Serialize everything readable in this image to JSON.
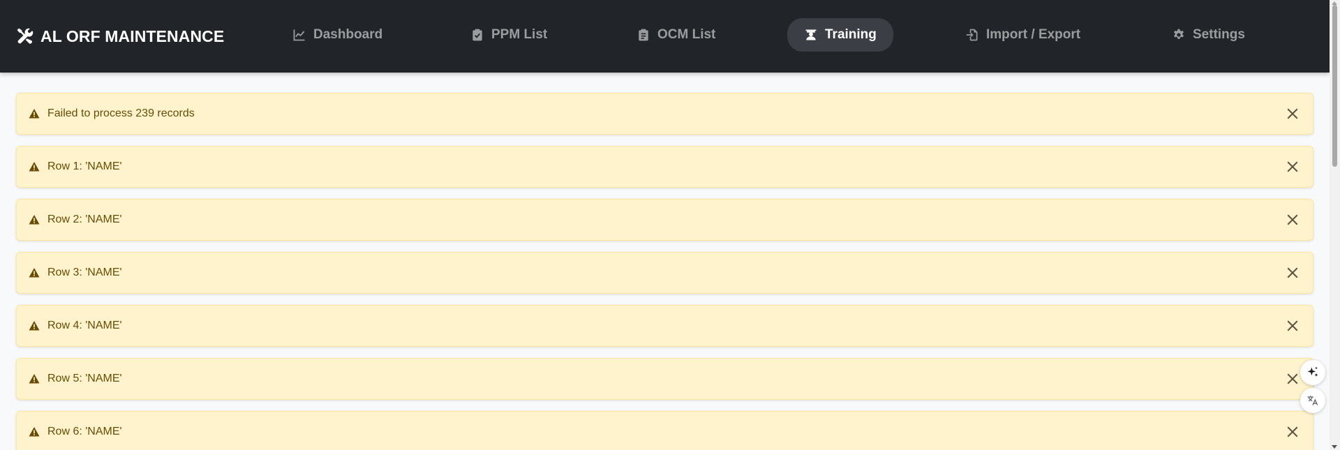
{
  "navbar": {
    "brand": {
      "label": "AL ORF MAINTENANCE",
      "icon": "tools-icon"
    },
    "items": [
      {
        "label": "Dashboard",
        "icon": "chart-line-icon",
        "active": false
      },
      {
        "label": "PPM List",
        "icon": "clipboard-check-icon",
        "active": false
      },
      {
        "label": "OCM List",
        "icon": "clipboard-list-icon",
        "active": false
      },
      {
        "label": "Training",
        "icon": "graduation-icon",
        "active": true
      },
      {
        "label": "Import / Export",
        "icon": "file-import-icon",
        "active": false
      },
      {
        "label": "Settings",
        "icon": "gear-icon",
        "active": false
      }
    ]
  },
  "alerts": [
    {
      "message": "Failed to process 239 records"
    },
    {
      "message": "Row 1: 'NAME'"
    },
    {
      "message": "Row 2: 'NAME'"
    },
    {
      "message": "Row 3: 'NAME'"
    },
    {
      "message": "Row 4: 'NAME'"
    },
    {
      "message": "Row 5: 'NAME'"
    },
    {
      "message": "Row 6: 'NAME'"
    }
  ],
  "floating": {
    "ai_icon": "sparkle-icon",
    "translate_icon": "translate-icon"
  },
  "colors": {
    "navbar_bg": "#212529",
    "active_pill": "#3b3f45",
    "alert_bg": "#fff3cd",
    "alert_text": "#664d03"
  }
}
